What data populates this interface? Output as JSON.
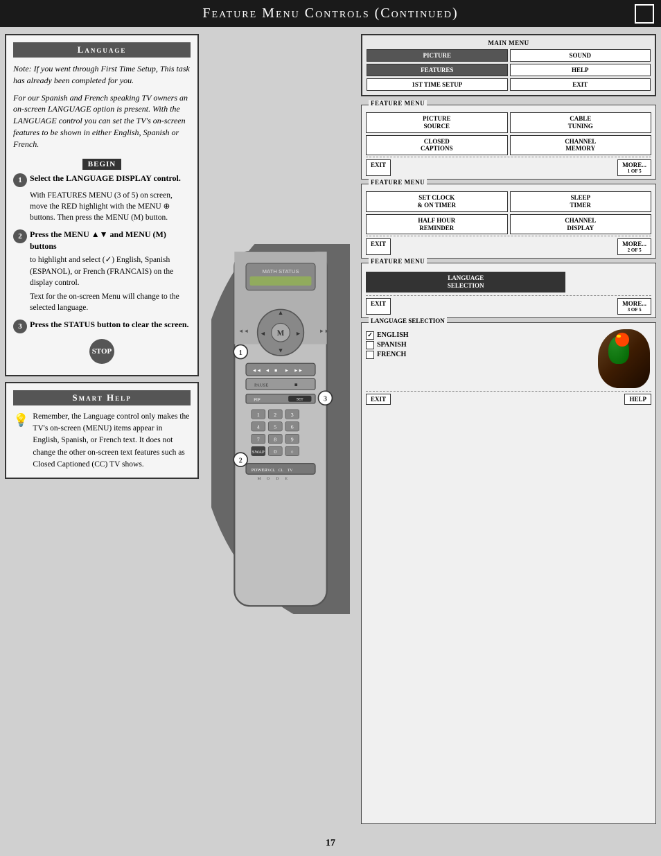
{
  "header": {
    "title": "Feature Menu Controls (Continued)"
  },
  "language_section": {
    "title": "Language",
    "note": "Note: If you went through First Time Setup, This task has already been completed for you.",
    "note2": "For our Spanish and French speaking TV owners an on-screen LANGUAGE option is present. With the LANGUAGE control you can set the TV's on-screen features to be shown in either English, Spanish or French.",
    "begin_label": "BEGIN",
    "step1": {
      "number": "1",
      "title": "Select the LANGUAGE DISPLAY control.",
      "body": "With FEATURES MENU (3 of 5) on screen, move the RED highlight with the MENU ⊕ buttons. Then press the MENU (M) button."
    },
    "step2": {
      "number": "2",
      "title": "Press the MENU ▲▼ and MENU (M) buttons",
      "body": "to highlight and select (✓) English, Spanish (ESPANOL), or French (FRANCAIS) on the display control."
    },
    "step2b": "Text for the on-screen Menu will change to the selected language.",
    "step3": {
      "number": "3",
      "title": "Press the STATUS button to clear the screen.",
      "body": ""
    },
    "stop_label": "STOP"
  },
  "smart_help": {
    "title": "Smart Help",
    "body": "Remember, the Language control only makes the TV's on-screen (MENU) items appear in English, Spanish, or French text. It does not change the other on-screen text features such as Closed Captioned (CC) TV shows."
  },
  "main_menu": {
    "label": "MAIN MENU",
    "buttons": [
      "PICTURE",
      "SOUND",
      "FEATURES",
      "HELP",
      "1ST TIME SETUP",
      "EXIT"
    ]
  },
  "feature_menu_1": {
    "label": "FEATURE MENU",
    "buttons": [
      "PICTURE SOURCE",
      "CABLE TUNING",
      "CLOSED CAPTIONS",
      "CHANNEL MEMORY",
      "EXIT",
      "MORE..."
    ],
    "page": "1 OF 5"
  },
  "feature_menu_2": {
    "label": "FEATURE MENU",
    "buttons": [
      "SET CLOCK & ON TIMER",
      "SLEEP TIMER",
      "HALF HOUR REMINDER",
      "CHANNEL DISPLAY",
      "EXIT",
      "MORE..."
    ],
    "page": "2 OF 5"
  },
  "feature_menu_3": {
    "label": "FEATURE MENU",
    "buttons": [
      "LANGUAGE SELECTION",
      "EXIT",
      "MORE..."
    ],
    "page": "3 OF 5"
  },
  "language_select": {
    "label": "LANGUAGE SELECTION",
    "options": [
      "ENGLISH",
      "SPANISH",
      "FRENCH"
    ],
    "checked": "ENGLISH",
    "buttons": [
      "EXIT",
      "HELP"
    ]
  },
  "page_number": "17"
}
